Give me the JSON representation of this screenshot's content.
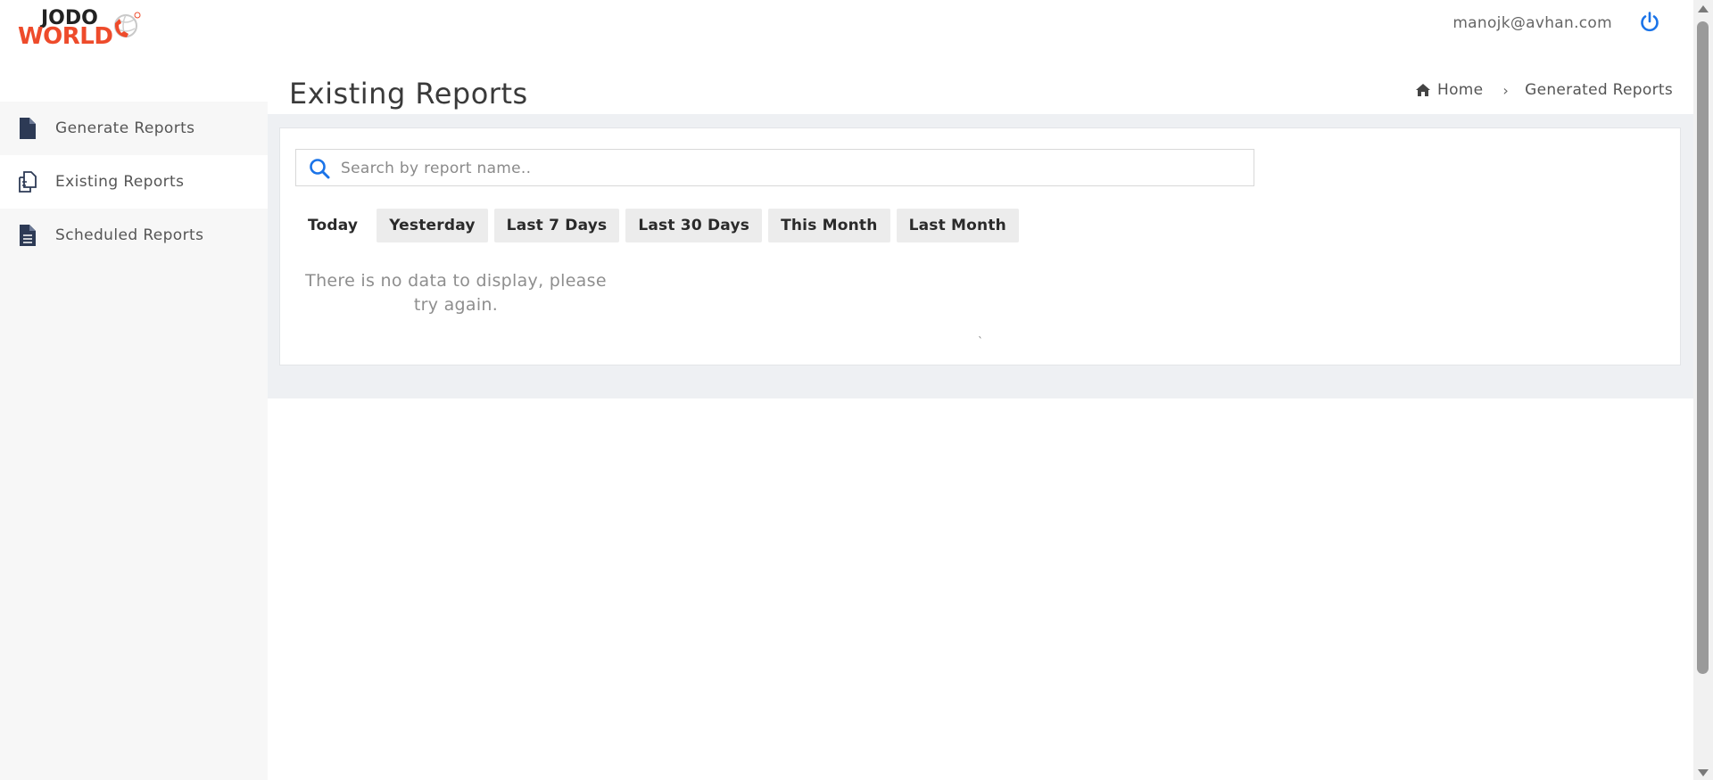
{
  "brand": {
    "logo_top": "JODO",
    "logo_bottom": "WORLD",
    "logo_color": "#ee4b2b",
    "accent_color": "#1a73e8"
  },
  "header": {
    "user_email": "manojk@avhan.com",
    "logout_icon": "power-icon"
  },
  "sidebar": {
    "items": [
      {
        "label": "Generate Reports",
        "icon": "file-icon",
        "active": false
      },
      {
        "label": "Existing Reports",
        "icon": "copy-icon",
        "active": true
      },
      {
        "label": "Scheduled Reports",
        "icon": "file-text-icon",
        "active": false
      }
    ]
  },
  "page": {
    "title": "Existing Reports",
    "breadcrumb": {
      "home": "Home",
      "separator": "›",
      "current": "Generated Reports"
    }
  },
  "search": {
    "placeholder": "Search by report name..",
    "value": ""
  },
  "filters": {
    "tabs": [
      {
        "label": "Today",
        "active": true
      },
      {
        "label": "Yesterday",
        "active": false
      },
      {
        "label": "Last 7 Days",
        "active": false
      },
      {
        "label": "Last 30 Days",
        "active": false
      },
      {
        "label": "This Month",
        "active": false
      },
      {
        "label": "Last Month",
        "active": false
      }
    ]
  },
  "empty_state": {
    "line1": "There is no data to display, please",
    "line2": "try again.",
    "tick": "`"
  }
}
